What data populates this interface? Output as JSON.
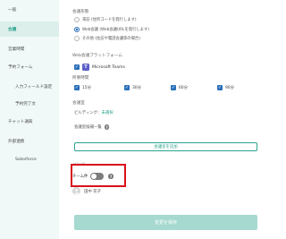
{
  "sidebar": {
    "items": [
      {
        "label": "一般"
      },
      {
        "label": "会議"
      },
      {
        "label": "営業時間"
      },
      {
        "label": "予約フォーム"
      },
      {
        "label": "入力フィールド設定"
      },
      {
        "label": "予約完了文"
      },
      {
        "label": "チャット通知"
      },
      {
        "label": "外部連携"
      },
      {
        "label": "Salesforce"
      }
    ],
    "active_index": 1
  },
  "meeting_format": {
    "label": "会議形態",
    "options": [
      {
        "label": "来訪 (住所コードを発行します)",
        "checked": false
      },
      {
        "label": "Web会議 (Web会議URLを発行します)",
        "checked": true
      },
      {
        "label": "その他 (往訪や電話会議等の場合)",
        "checked": false
      }
    ]
  },
  "web_platform": {
    "label": "Web会議プラットフォーム",
    "option": "Microsoft Teams",
    "checked": true
  },
  "duration": {
    "label": "所要時間",
    "options": [
      {
        "label": "15分",
        "checked": true
      },
      {
        "label": "30分",
        "checked": true
      },
      {
        "label": "60分",
        "checked": true
      },
      {
        "label": "90分",
        "checked": true
      }
    ]
  },
  "location": {
    "label": "会議室",
    "building_label": "ビルディング：",
    "building_value": "未選択",
    "list_label": "会議室候補一覧"
  },
  "add_room_button": "会議室を追加",
  "members": {
    "label": "メンバー",
    "team_toggle_label": "チーム件",
    "team_toggle_on": false,
    "member_name": "田中 花子"
  },
  "save_button": "変更を保存",
  "colors": {
    "accent": "#2ba38f",
    "checkbox": "#2b6fb8",
    "highlight": "#d8121b"
  }
}
